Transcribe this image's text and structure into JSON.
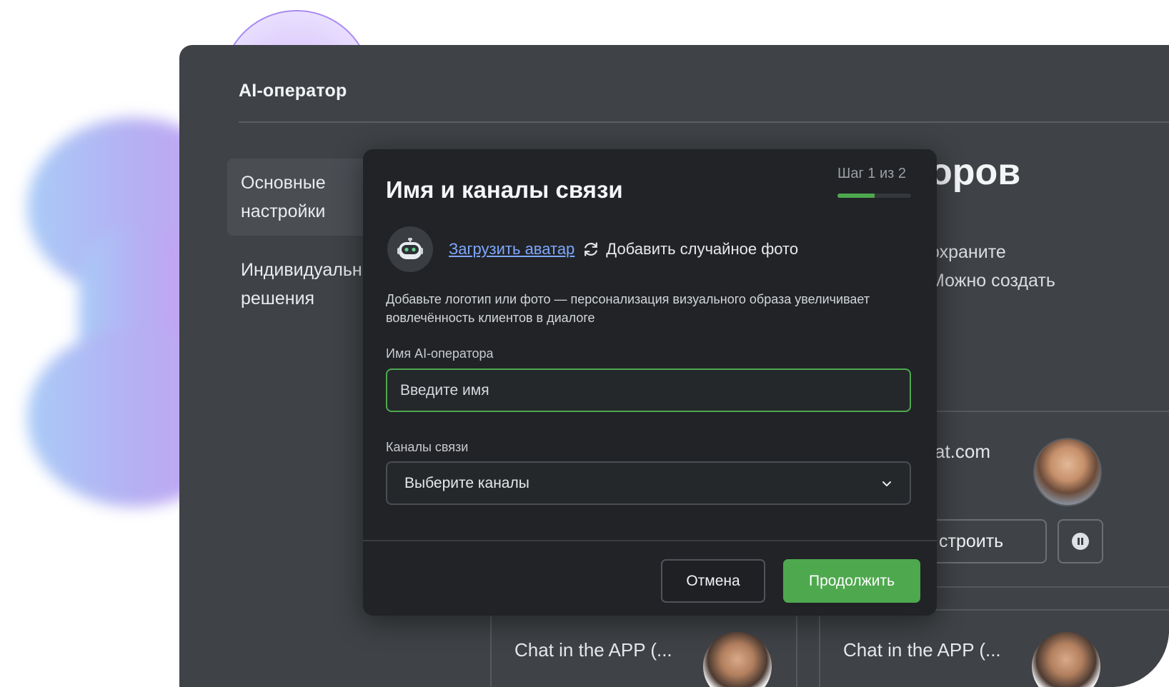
{
  "app": {
    "title": "AI-оператор",
    "nav": [
      {
        "label": "Основные\nнастройки",
        "active": true
      },
      {
        "label": "Индивидуальные\nрешения",
        "active": false
      }
    ],
    "background": {
      "heading_fragment": "оров",
      "text_fragment_1": "охраните",
      "text_fragment_2": "Можно создать",
      "card_domain_fragment": "at.com",
      "configure_fragment": "строить",
      "bottom_cards": [
        "Chat in the APP (...",
        "Chat in the APP (..."
      ]
    }
  },
  "modal": {
    "title": "Имя и каналы связи",
    "step_label": "Шаг 1 из 2",
    "step_progress": 0.5,
    "upload_avatar": "Загрузить аватар",
    "random_photo": "Добавить случайное фото",
    "hint": "Добавьте логотип или фото — персонализация визуального образа увеличивает вовлечённость клиентов в диалоге",
    "name_label": "Имя AI-оператора",
    "name_placeholder": "Введите имя",
    "name_value": "",
    "channels_label": "Каналы связи",
    "channels_placeholder": "Выберите каналы",
    "cancel": "Отмена",
    "continue": "Продолжить"
  },
  "colors": {
    "accent": "#4ea84e",
    "link": "#7ea7ff",
    "modal_bg": "#212326",
    "app_bg": "#3f4246"
  },
  "icons": {
    "avatar": "robot-icon",
    "random": "refresh-icon",
    "select": "chevron-down-icon",
    "pause": "pause-icon"
  }
}
